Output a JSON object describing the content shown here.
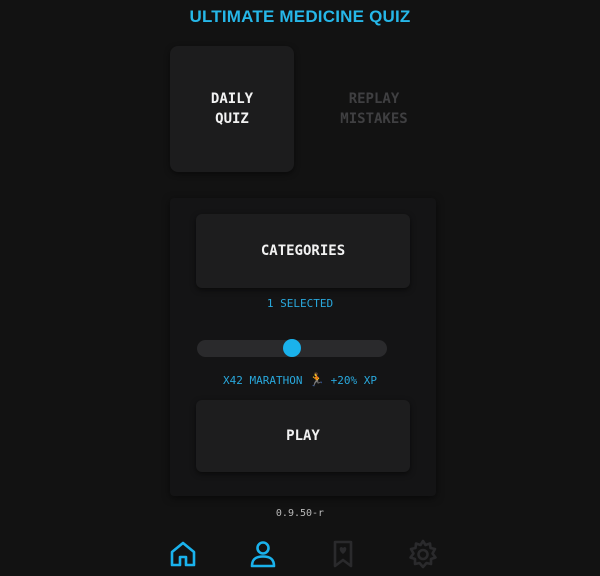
{
  "app": {
    "title": "ULTIMATE MEDICINE QUIZ",
    "version": "0.9.50-r"
  },
  "modes": {
    "daily_label": "DAILY\nQUIZ",
    "replay_label": "REPLAY\nMISTAKES"
  },
  "categories": {
    "button_label": "CATEGORIES",
    "selected_text": "1 SELECTED"
  },
  "slider": {
    "value": 0.5
  },
  "marathon": {
    "multiplier": "X42 MARATHON",
    "icon": "runner-icon",
    "bonus": "+20% XP"
  },
  "play": {
    "label": "PLAY"
  },
  "nav": {
    "items": [
      {
        "icon": "home-icon",
        "active": true
      },
      {
        "icon": "profile-icon",
        "active": true
      },
      {
        "icon": "bookmark-heart-icon",
        "active": false
      },
      {
        "icon": "settings-gear-icon",
        "active": false
      }
    ]
  },
  "colors": {
    "accent": "#1ab2ec",
    "text_accent": "#29a8dc",
    "inactive_icon": "#2a2a2c",
    "background": "#121212",
    "tile": "#1d1d1e",
    "runner": "#f29a2e"
  }
}
